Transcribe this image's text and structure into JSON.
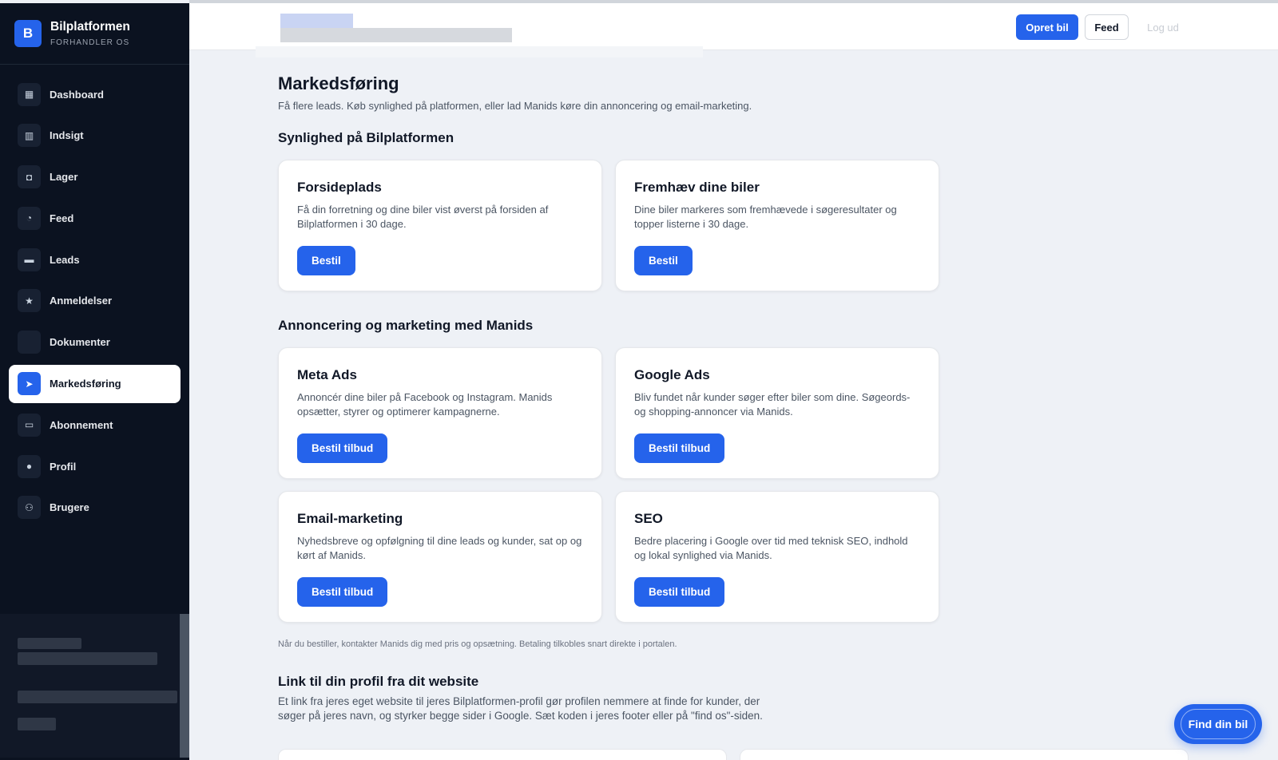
{
  "brand": {
    "logo_letter": "B",
    "title": "Bilplatformen",
    "subtitle": "FORHANDLER OS"
  },
  "sidebar": {
    "items": [
      {
        "label": "Dashboard",
        "icon": "dashboard-icon",
        "glyph": "▦"
      },
      {
        "label": "Indsigt",
        "icon": "bar-chart-icon",
        "glyph": "▥"
      },
      {
        "label": "Lager",
        "icon": "car-icon",
        "glyph": "◘"
      },
      {
        "label": "Feed",
        "icon": "rss-icon",
        "glyph": "◔"
      },
      {
        "label": "Leads",
        "icon": "chat-icon",
        "glyph": "▬"
      },
      {
        "label": "Anmeldelser",
        "icon": "star-icon",
        "glyph": "★"
      },
      {
        "label": "Dokumenter",
        "icon": "document-icon",
        "glyph": ""
      },
      {
        "label": "Markedsføring",
        "icon": "send-icon",
        "glyph": "➤",
        "active": true
      },
      {
        "label": "Abonnement",
        "icon": "credit-card-icon",
        "glyph": "▭"
      },
      {
        "label": "Profil",
        "icon": "user-icon",
        "glyph": "●"
      },
      {
        "label": "Brugere",
        "icon": "users-icon",
        "glyph": "⚇"
      }
    ]
  },
  "topbar": {
    "create_label": "Opret bil",
    "feed_label": "Feed",
    "logout_label": "Log ud"
  },
  "page": {
    "title": "Markedsføring",
    "subtitle": "Få flere leads. Køb synlighed på platformen, eller lad Manids køre din annoncering og email-marketing."
  },
  "section_visibility": {
    "title": "Synlighed på Bilplatformen",
    "cards": [
      {
        "title": "Forsideplads",
        "desc": "Få din forretning og dine biler vist øverst på forsiden af Bilplatformen i 30 dage.",
        "button": "Bestil"
      },
      {
        "title": "Fremhæv dine biler",
        "desc": "Dine biler markeres som fremhævede i søgeresultater og topper listerne i 30 dage.",
        "button": "Bestil"
      }
    ]
  },
  "section_marketing": {
    "title": "Annoncering og marketing med Manids",
    "cards": [
      {
        "title": "Meta Ads",
        "desc": "Annoncér dine biler på Facebook og Instagram. Manids opsætter, styrer og optimerer kampagnerne.",
        "button": "Bestil tilbud"
      },
      {
        "title": "Google Ads",
        "desc": "Bliv fundet når kunder søger efter biler som dine. Søgeords- og shopping-annoncer via Manids.",
        "button": "Bestil tilbud"
      },
      {
        "title": "Email-marketing",
        "desc": "Nyhedsbreve og opfølgning til dine leads og kunder, sat op og kørt af Manids.",
        "button": "Bestil tilbud"
      },
      {
        "title": "SEO",
        "desc": "Bedre placering i Google over tid med teknisk SEO, indhold og lokal synlighed via Manids.",
        "button": "Bestil tilbud"
      }
    ],
    "footnote": "Når du bestiller, kontakter Manids dig med pris og opsætning. Betaling tilkobles snart direkte i portalen."
  },
  "section_link": {
    "title": "Link til din profil fra dit website",
    "desc": "Et link fra jeres eget website til jeres Bilplatformen-profil gør profilen nemmere at finde for kunder, der søger på jeres navn, og styrker begge sider i Google. Sæt koden i jeres footer eller på \"find os\"-siden."
  },
  "floating": {
    "find_label": "Find din bil"
  },
  "colors": {
    "accent": "#2563eb",
    "sidebar_bg": "#0b1220",
    "page_bg": "#eef1f6"
  }
}
